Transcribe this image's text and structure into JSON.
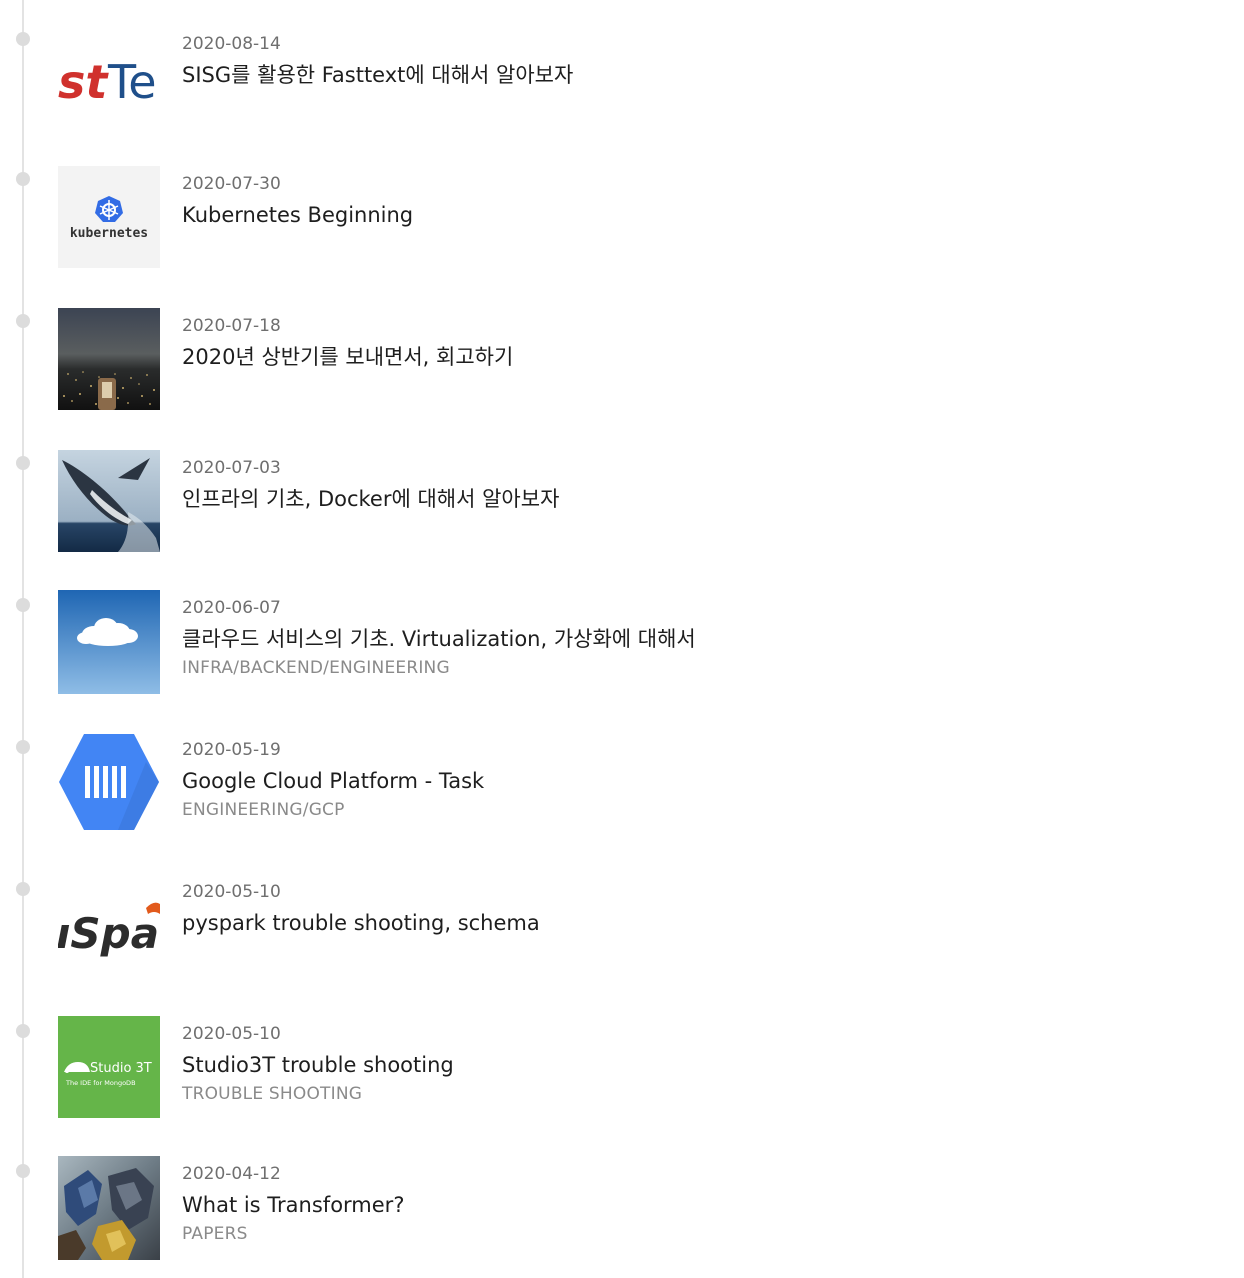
{
  "posts": [
    {
      "date": "2020-08-14",
      "title": "SISG를 활용한 Fasttext에 대해서 알아보자",
      "category": "",
      "thumbnail": "fasttext-logo",
      "thumb_text": "stTe"
    },
    {
      "date": "2020-07-30",
      "title": "Kubernetes Beginning",
      "category": "",
      "thumbnail": "kubernetes-logo",
      "thumb_text": "kubernetes"
    },
    {
      "date": "2020-07-18",
      "title": "2020년 상반기를 보내면서, 회고하기",
      "category": "",
      "thumbnail": "city-night-photo"
    },
    {
      "date": "2020-07-03",
      "title": "인프라의 기초, Docker에 대해서 알아보자",
      "category": "",
      "thumbnail": "whale-photo"
    },
    {
      "date": "2020-06-07",
      "title": "클라우드 서비스의 기초. Virtualization, 가상화에 대해서",
      "category": "INFRA/BACKEND/ENGINEERING",
      "thumbnail": "cloud-sky-photo"
    },
    {
      "date": "2020-05-19",
      "title": "Google Cloud Platform - Task",
      "category": "ENGINEERING/GCP",
      "thumbnail": "gcp-tasks-logo"
    },
    {
      "date": "2020-05-10",
      "title": "pyspark trouble shooting, schema",
      "category": "",
      "thumbnail": "spark-logo",
      "thumb_text": "Spar"
    },
    {
      "date": "2020-05-10",
      "title": "Studio3T trouble shooting",
      "category": "TROUBLE SHOOTING",
      "thumbnail": "studio3t-logo",
      "thumb_text": "Studio 3T",
      "thumb_subtext": "The IDE for MongoDB"
    },
    {
      "date": "2020-04-12",
      "title": "What is Transformer?",
      "category": "PAPERS",
      "thumbnail": "transformer-robot-photo"
    }
  ],
  "colors": {
    "timeline": "#e3e3e3",
    "dot": "#dcdcdc",
    "date": "#6f6f6f",
    "title": "#1e1e1e",
    "category": "#8a8a8a",
    "fasttext_red": "#d0312d",
    "fasttext_blue": "#1f4f8a",
    "kubernetes_blue": "#326ce5",
    "gcp_blue": "#4285f4",
    "spark_orange": "#e25a1c",
    "studio3t_green": "#65b549"
  }
}
